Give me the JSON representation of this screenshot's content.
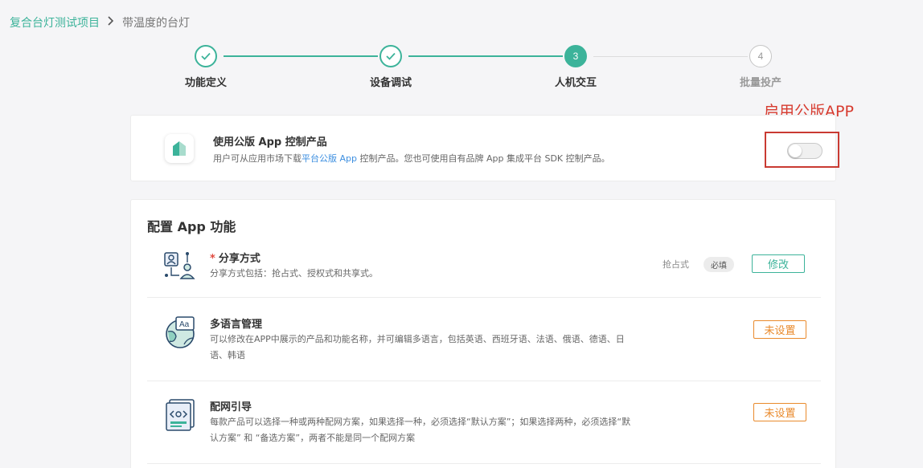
{
  "breadcrumb": {
    "root": "复合台灯测试项目",
    "separator": ">",
    "current": "带温度的台灯"
  },
  "steps": [
    {
      "label": "功能定义",
      "state": "done",
      "num": ""
    },
    {
      "label": "设备调试",
      "state": "done",
      "num": ""
    },
    {
      "label": "人机交互",
      "state": "active",
      "num": "3"
    },
    {
      "label": "批量投产",
      "state": "todo",
      "num": "4"
    }
  ],
  "annotation": "启用公版APP",
  "public_app": {
    "title": "使用公版 App 控制产品",
    "desc_pre": "用户可从应用市场下载",
    "desc_link": "平台公版 App",
    "desc_post": " 控制产品。您也可使用自有品牌 App 集成平台 SDK 控制产品。",
    "toggle_on": false
  },
  "config": {
    "title": "配置 App 功能",
    "rows": [
      {
        "required_mark": "*",
        "title": "分享方式",
        "desc": "分享方式包括：抢占式、授权式和共享式。",
        "value": "抢占式",
        "required_tag": "必填",
        "action": "修改"
      },
      {
        "title": "多语言管理",
        "desc": "可以修改在APP中展示的产品和功能名称，并可编辑多语言，包括英语、西班牙语、法语、俄语、德语、日语、韩语",
        "action": "未设置"
      },
      {
        "title": "配网引导",
        "desc": "每款产品可以选择一种或两种配网方案，如果选择一种，必须选择“默认方案”；如果选择两种，必须选择“默认方案” 和 “备选方案”，两者不能是同一个配网方案",
        "action": "未设置"
      }
    ]
  },
  "colors": {
    "accent": "#3cb39a",
    "warning": "#e98a2c",
    "annotation": "#d73b2f",
    "link": "#3d8fe0"
  }
}
